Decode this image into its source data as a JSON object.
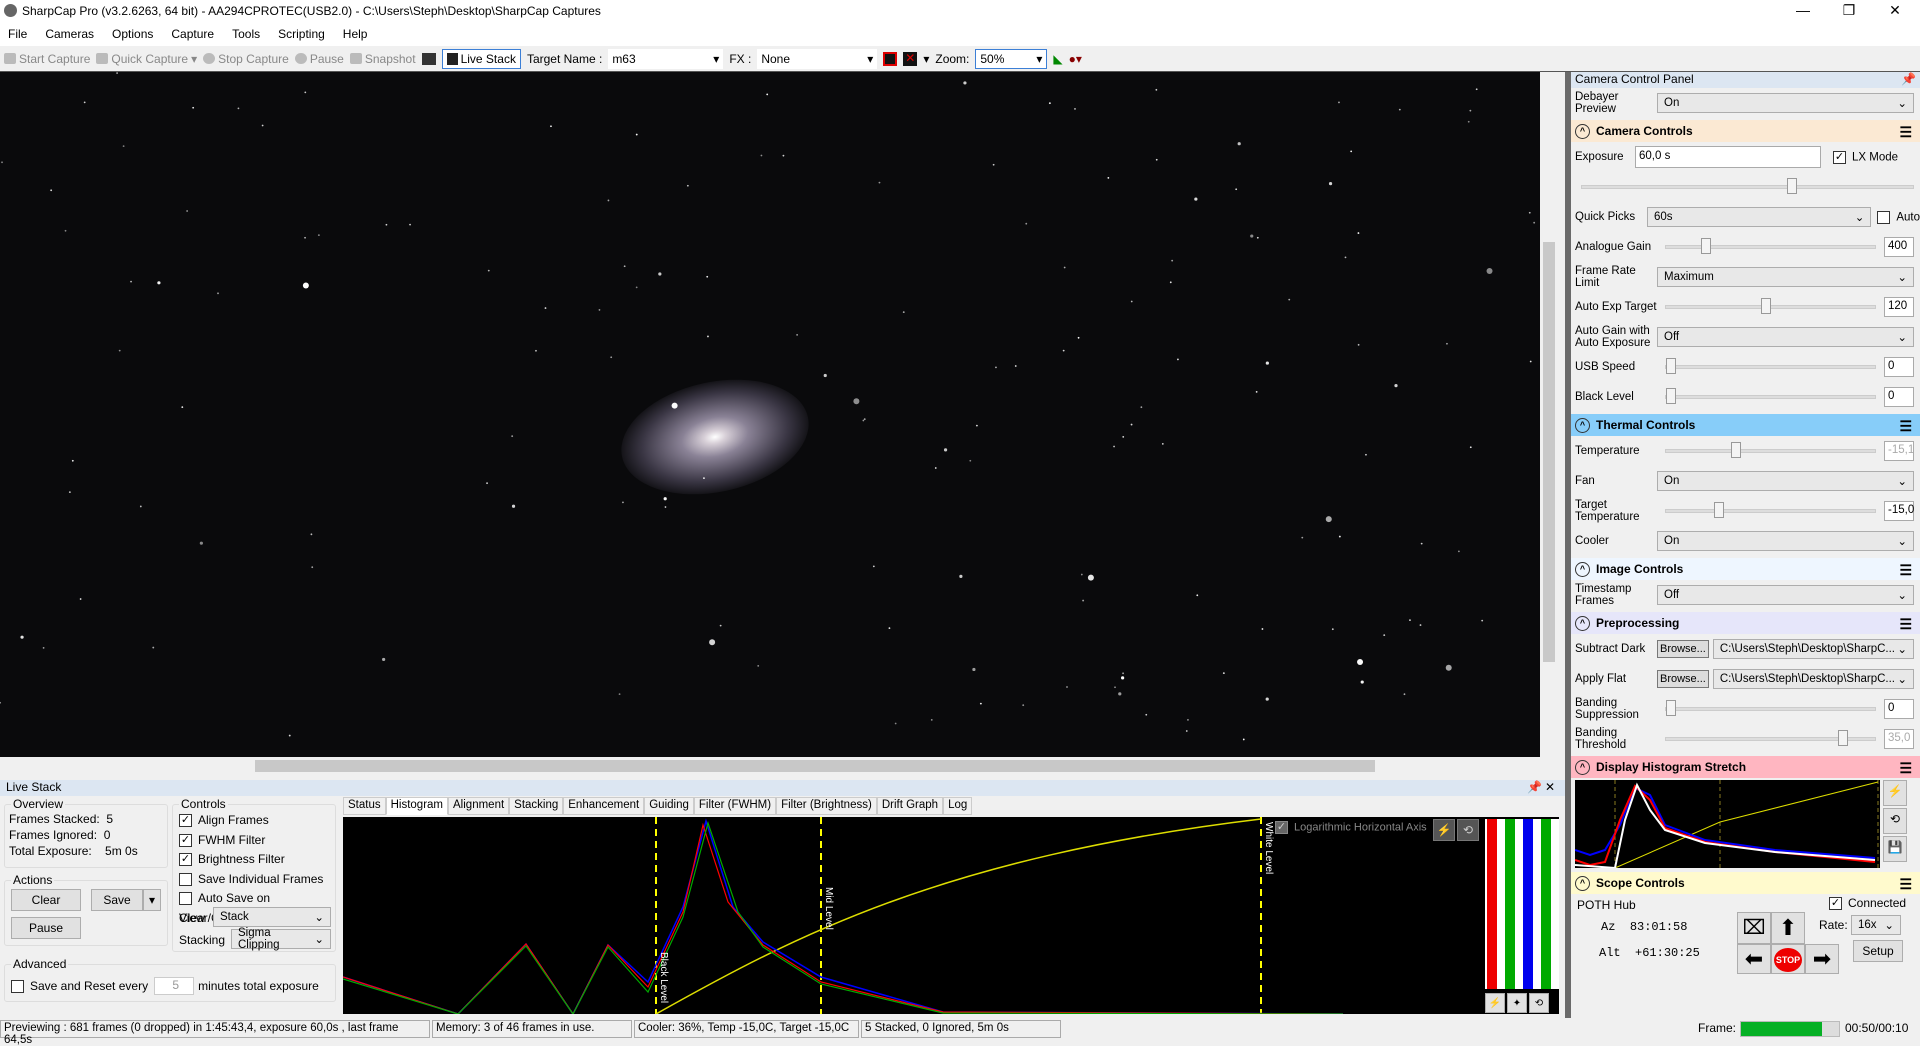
{
  "window": {
    "title": "SharpCap Pro (v3.2.6263, 64 bit) - AA294CPROTEC(USB2.0) - C:\\Users\\Steph\\Desktop\\SharpCap Captures",
    "min": "—",
    "max": "❐",
    "close": "✕"
  },
  "menu": [
    "File",
    "Cameras",
    "Options",
    "Capture",
    "Tools",
    "Scripting",
    "Help"
  ],
  "toolbar": {
    "start_capture": "Start Capture",
    "quick_capture": "Quick Capture",
    "stop_capture": "Stop Capture",
    "pause": "Pause",
    "snapshot": "Snapshot",
    "live_stack": "Live Stack",
    "target_label": "Target Name :",
    "target_value": "m63",
    "fx_label": "FX :",
    "fx_value": "None",
    "zoom_label": "Zoom:",
    "zoom_value": "50%"
  },
  "panel": {
    "title": "Camera Control Panel",
    "debayer": {
      "label": "Debayer Preview",
      "value": "On"
    },
    "camera_controls": {
      "title": "Camera Controls",
      "color": "#fbe9d3",
      "exposure_label": "Exposure",
      "exposure_value": "60,0 s",
      "lx_mode": "LX Mode",
      "lx_checked": true,
      "quick_picks_label": "Quick Picks",
      "quick_picks_value": "60s",
      "auto": "Auto",
      "analogue_gain": {
        "label": "Analogue Gain",
        "value": "400"
      },
      "frame_rate": {
        "label": "Frame Rate Limit",
        "value": "Maximum"
      },
      "auto_exp": {
        "label": "Auto Exp Target",
        "value": "120"
      },
      "auto_gain": {
        "label": "Auto Gain with Auto Exposure",
        "value": "Off"
      },
      "usb_speed": {
        "label": "USB Speed",
        "value": "0"
      },
      "black_level": {
        "label": "Black Level",
        "value": "0"
      }
    },
    "thermal": {
      "title": "Thermal Controls",
      "color": "#87cdf9",
      "temperature": {
        "label": "Temperature",
        "value": "-15,1"
      },
      "fan": {
        "label": "Fan",
        "value": "On"
      },
      "target_temp": {
        "label": "Target Temperature",
        "value": "-15,0"
      },
      "cooler": {
        "label": "Cooler",
        "value": "On"
      }
    },
    "image_controls": {
      "title": "Image Controls",
      "color": "#eef6ff",
      "timestamp": {
        "label": "Timestamp Frames",
        "value": "Off"
      }
    },
    "preprocessing": {
      "title": "Preprocessing",
      "color": "#e6e6fa",
      "browse": "Browse...",
      "dark": {
        "label": "Subtract Dark",
        "value": "C:\\Users\\Steph\\Desktop\\SharpC..."
      },
      "flat": {
        "label": "Apply Flat",
        "value": "C:\\Users\\Steph\\Desktop\\SharpC..."
      },
      "banding_supp": {
        "label": "Banding Suppression",
        "value": "0"
      },
      "banding_thr": {
        "label": "Banding Threshold",
        "value": "35,0"
      }
    },
    "histogram_stretch": {
      "title": "Display Histogram Stretch",
      "color": "#ffb6c1"
    },
    "scope": {
      "title": "Scope Controls",
      "color": "#fffacd",
      "device": "POTH Hub",
      "connected": "Connected",
      "az_label": "Az",
      "az": "83:01:58",
      "alt_label": "Alt",
      "alt": "+61:30:25",
      "rate_label": "Rate:",
      "rate": "16x",
      "setup": "Setup",
      "stop": "STOP"
    }
  },
  "live_stack": {
    "title": "Live Stack",
    "overview": {
      "title": "Overview",
      "frames_stacked": "Frames Stacked:  5",
      "frames_ignored": "Frames Ignored:  0",
      "total_exposure": "Total Exposure:    5m 0s"
    },
    "actions": {
      "title": "Actions",
      "clear": "Clear",
      "save": "Save",
      "pause": "Pause"
    },
    "controls": {
      "title": "Controls",
      "checks": [
        {
          "label": "Align Frames",
          "checked": true
        },
        {
          "label": "FWHM Filter",
          "checked": true
        },
        {
          "label": "Brightness Filter",
          "checked": true
        },
        {
          "label": "Save Individual Frames",
          "checked": false
        },
        {
          "label": "Auto Save on Clear/Close",
          "checked": false
        }
      ],
      "view_label": "View",
      "view_value": "Stack",
      "stacking_label": "Stacking",
      "stacking_value": "Sigma Clipping"
    },
    "advanced": {
      "title": "Advanced",
      "save_reset": "Save and Reset every",
      "minutes": "5",
      "suffix": "minutes total exposure"
    },
    "tabs": [
      "Status",
      "Histogram",
      "Alignment",
      "Stacking",
      "Enhancement",
      "Guiding",
      "Filter (FWHM)",
      "Filter (Brightness)",
      "Drift Graph",
      "Log"
    ],
    "active_tab": "Histogram",
    "histogram": {
      "log_axis": "Logarithmic Horizontal Axis",
      "black_level": "Black Level",
      "mid_level": "Mid Level",
      "white_level": "White Level"
    }
  },
  "status": {
    "preview": "Previewing : 681 frames (0 dropped) in 1:45:43,4, exposure 60,0s , last frame 64,5s",
    "memory": "Memory: 3 of 46 frames in use.",
    "cooler": "Cooler: 36%, Temp -15,0C, Target -15,0C",
    "stack": "5 Stacked, 0 Ignored, 5m 0s",
    "frame_label": "Frame:",
    "frame_progress": 0.83,
    "frame_time": "00:50/00:10"
  }
}
